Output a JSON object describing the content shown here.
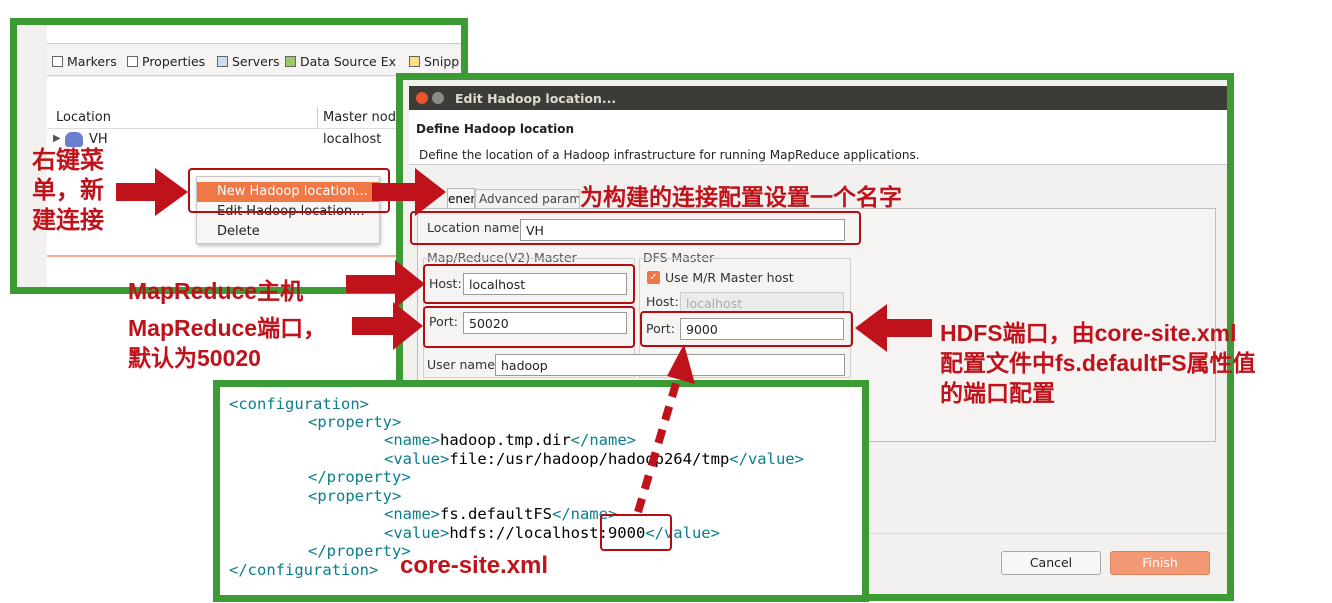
{
  "eclipse": {
    "tabs": [
      "Markers",
      "Properties",
      "Servers",
      "Data Source Ex",
      "Snipp"
    ],
    "columns": [
      "Location",
      "Master node"
    ],
    "row": {
      "location": "VH",
      "master": "localhost"
    },
    "context_menu": [
      "New Hadoop location...",
      "Edit Hadoop location...",
      "Delete"
    ]
  },
  "dialog": {
    "title": "Edit Hadoop location...",
    "header": "Define Hadoop location",
    "description": "Define the location of a Hadoop infrastructure for running MapReduce applications.",
    "tabs": [
      "eneral",
      "Advanced paramete"
    ],
    "location_label": "Location name:",
    "location_value": "VH",
    "mr_group": "Map/Reduce(V2) Master",
    "mr_host_label": "Host:",
    "mr_host_value": "localhost",
    "mr_port_label": "Port:",
    "mr_port_value": "50020",
    "dfs_group": "DFS Master",
    "dfs_checkbox": "Use M/R Master host",
    "dfs_host_label": "Host:",
    "dfs_host_value": "localhost",
    "dfs_port_label": "Port:",
    "dfs_port_value": "9000",
    "user_label": "User name:",
    "user_value": "hadoop",
    "cancel": "Cancel",
    "finish": "Finish"
  },
  "annotations": {
    "right_click_line1": "右键菜",
    "right_click_line2": "单，新",
    "right_click_line3": "建连接",
    "name_note": "为构建的连接配置设置一个名字",
    "mr_host_note": "MapReduce主机",
    "mr_port_line1": "MapReduce端口，",
    "mr_port_line2": "默认为50020",
    "hdfs_line1": "HDFS端口，由core-site.xml",
    "hdfs_line2": "配置文件中fs.defaultFS属性值",
    "hdfs_line3": "的端口配置",
    "core_site": "core-site.xml"
  },
  "code": {
    "l1": "<configuration>",
    "l2": "<property>",
    "l3a": "<name>",
    "l3b": "hadoop.tmp.dir",
    "l3c": "</name>",
    "l4a": "<value>",
    "l4b": "file:/usr/hadoop/hadoop264/tmp",
    "l4c": "</value>",
    "l5": "</property>",
    "l6": "<property>",
    "l7a": "<name>",
    "l7b": "fs.defaultFS",
    "l7c": "</name>",
    "l8a": "<value>",
    "l8b": "hdfs://localhost",
    "l8c": ":9000",
    "l8d": "</value>",
    "l9": "</property>",
    "l10": "</configuration>"
  },
  "colors": {
    "frame_green": "#3d9b35",
    "annotation_red": "#c0121a",
    "menu_highlight": "#f07746",
    "finish_button": "#f39a75"
  }
}
